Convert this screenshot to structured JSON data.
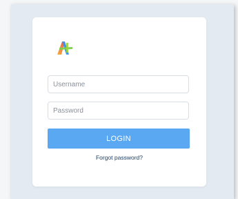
{
  "app": {
    "logo_icon": "brand-logo-icon",
    "accent_color": "#5aa8f2"
  },
  "login_form": {
    "username": {
      "placeholder": "Username",
      "value": ""
    },
    "password": {
      "placeholder": "Password",
      "value": ""
    },
    "login_label": "LOGIN",
    "forgot_label": "Forgot password?"
  }
}
